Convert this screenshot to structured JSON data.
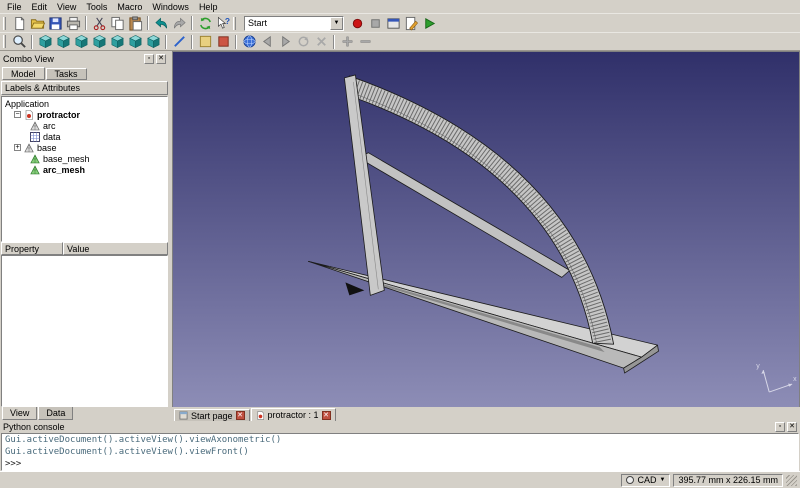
{
  "menu": {
    "items": [
      "File",
      "Edit",
      "View",
      "Tools",
      "Macro",
      "Windows",
      "Help"
    ]
  },
  "toolbars": {
    "workbench_selector": {
      "value": "Start"
    },
    "standard_icons": [
      "new-document",
      "open-document",
      "save-document",
      "print",
      "cut",
      "copy",
      "paste",
      "undo",
      "redo",
      "refresh",
      "whats-this",
      "record-macro",
      "stop-macro",
      "macro-dialog",
      "edit-macro",
      "execute-macro"
    ],
    "view_icons": [
      "fit-all",
      "axonometric-view",
      "front-view",
      "top-view",
      "right-view",
      "rear-view",
      "bottom-view",
      "left-view",
      "measure-distance",
      "start-page",
      "texture-view",
      "web-browser",
      "nav-back",
      "nav-forward",
      "nav-refresh",
      "nav-stop",
      "zoom-in",
      "zoom-out"
    ]
  },
  "combo_view": {
    "title": "Combo View",
    "tabs": [
      "Model",
      "Tasks"
    ],
    "tree_header": "Labels & Attributes",
    "root": "Application",
    "tree_items": [
      "protractor",
      "arc",
      "data",
      "base",
      "base_mesh",
      "arc_mesh"
    ],
    "property_columns": [
      "Property",
      "Value"
    ],
    "bottom_tabs": [
      "View",
      "Data"
    ]
  },
  "viewport": {
    "mdi_tabs": [
      "Start page",
      "protractor : 1"
    ],
    "gradient_top": "#30306a",
    "gradient_bottom": "#8d8db6",
    "model_color": "#c9c9c9",
    "model_edge_color": "#1c1c1c"
  },
  "python_console": {
    "title": "Python console",
    "lines": [
      "Gui.activeDocument().activeView().viewAxonometric()",
      "Gui.activeDocument().activeView().viewFront()",
      ">>> "
    ]
  },
  "status_bar": {
    "navigation_style": "CAD",
    "dimensions": "395.77 mm x 226.15 mm"
  }
}
